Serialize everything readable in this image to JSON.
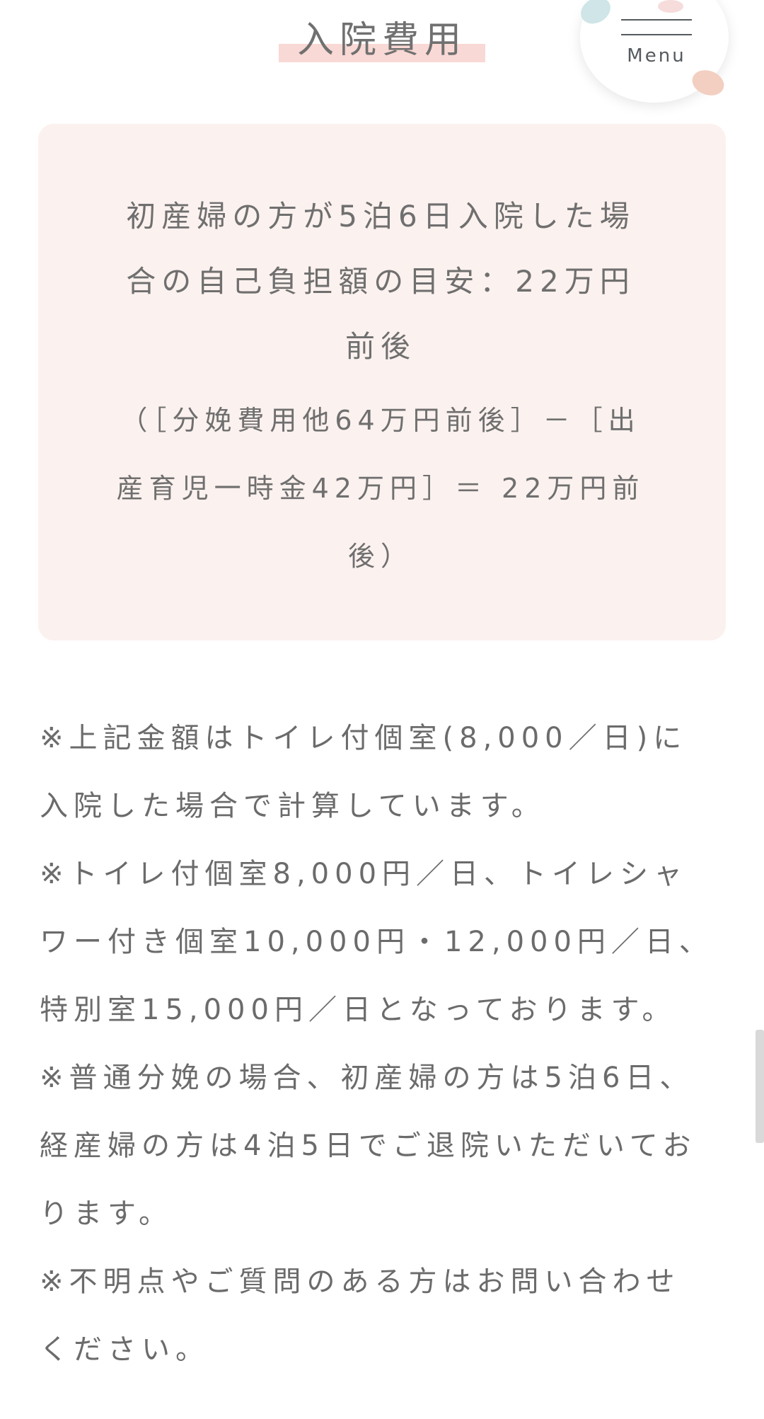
{
  "header": {
    "title": "入院費用",
    "menu_label": "Menu"
  },
  "cost_box": {
    "main_lines": [
      "初産婦の方が5泊6日入院した場",
      "合の自己負担額の目安：22万円",
      "前後"
    ],
    "formula_lines": [
      "（［分娩費用他64万円前後］－［出",
      "産育児一時金42万円］＝ 22万円前",
      "後）"
    ]
  },
  "notes": [
    "※上記金額はトイレ付個室(8,000／日)に",
    "入院した場合で計算しています。",
    "※トイレ付個室8,000円／日、トイレシャ",
    "ワー付き個室10,000円・12,000円／日、",
    "特別室15,000円／日となっております。",
    "※普通分娩の場合、初産婦の方は5泊6日、",
    "経産婦の方は4泊5日でご退院いただいてお",
    "ります。",
    "※不明点やご質問のある方はお問い合わせ",
    "ください。"
  ],
  "colors": {
    "title_highlight": "#f9d9d5",
    "box_background": "#fbf1ee",
    "text": "#6b6b6b"
  },
  "icons": {
    "menu": "hamburger-icon"
  }
}
